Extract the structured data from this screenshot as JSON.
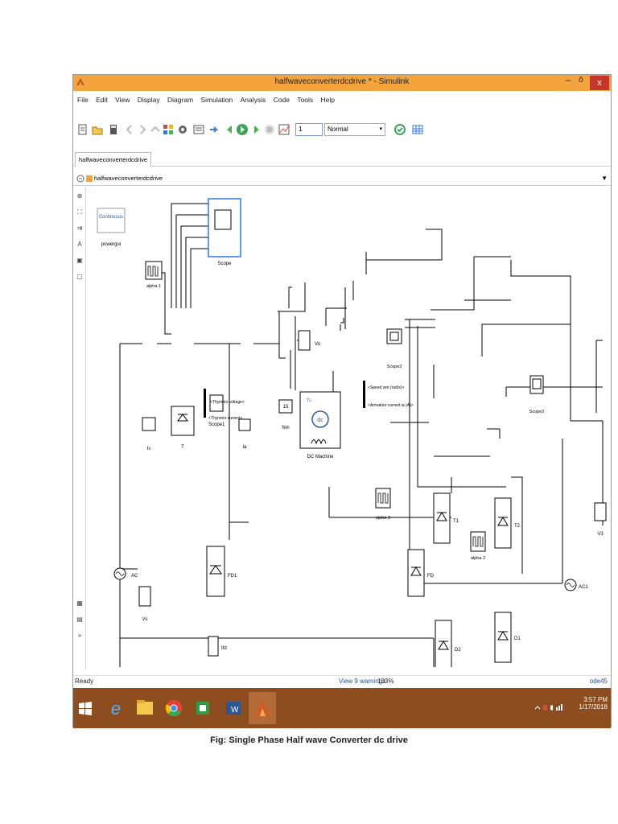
{
  "window": {
    "title": "halfwaveconverterdcdrive * - Simulink",
    "controls": {
      "minimize": "–",
      "maximize": "ō",
      "close": "x"
    }
  },
  "menu": [
    "File",
    "Edit",
    "View",
    "Display",
    "Diagram",
    "Simulation",
    "Analysis",
    "Code",
    "Tools",
    "Help"
  ],
  "toolbar": {
    "stop_time": "1",
    "sim_mode": "Normal"
  },
  "tab": {
    "label": "halfwaveconverterdcdrive"
  },
  "address": {
    "path": "halfwaveconverterdcdrive"
  },
  "blocks": {
    "powergui_top": "Continuous",
    "powergui_label": "powergui",
    "scope": "Scope",
    "scope1": "Scope1",
    "scope2": "Scope2",
    "scope3": "Scope3",
    "alpha1": "alpha 1",
    "alpha2": "alpha 2",
    "alpha3": "alpha 3",
    "thyristor_t": "T",
    "is": "Is",
    "ia": "Ia",
    "vo": "Vo",
    "ac": "AC",
    "vs": "Vs",
    "fd1": "FD1",
    "ifd": "Ifd",
    "const_15": "15",
    "nm": "Nm",
    "dc_machine": "DC Machine",
    "dc": "dc",
    "tl": "TL",
    "speed_sig": "<Speed wm (rad/s)>",
    "armature_sig": "<Armature current ia (A)>",
    "thyr_voltage": "<Thyristor voltage>",
    "thyr_current": "<Thyristor current>",
    "fd": "FD",
    "t1": "T1",
    "t2": "T2",
    "d1": "D1",
    "d2": "D2",
    "ac1": "AC1",
    "v3": "V3"
  },
  "status": {
    "ready": "Ready",
    "warnings": "View 9 warnings",
    "zoom": "103%",
    "solver": "ode45"
  },
  "tray": {
    "time": "3:57 PM",
    "date": "1/17/2018"
  },
  "caption": "Fig:  Single Phase Half wave Converter dc drive",
  "colors": {
    "titlebar": "#f3a43c",
    "taskbar": "#8d4d1f",
    "close": "#c7362b",
    "link": "#1f4fa3"
  }
}
